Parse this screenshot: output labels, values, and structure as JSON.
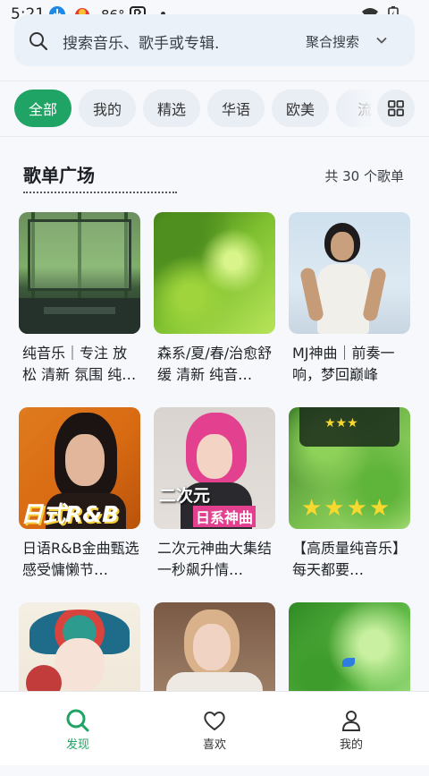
{
  "status_bar": {
    "time": "5:21",
    "temperature": "86°",
    "icons": [
      "download-icon",
      "app-badge-icon",
      "b-app-icon",
      "wifi-icon",
      "battery-icon"
    ]
  },
  "search": {
    "placeholder": "搜索音乐、歌手或专辑.",
    "mode": "聚合搜索"
  },
  "chips": [
    {
      "label": "全部",
      "active": true
    },
    {
      "label": "我的",
      "active": false
    },
    {
      "label": "精选",
      "active": false
    },
    {
      "label": "华语",
      "active": false
    },
    {
      "label": "欧美",
      "active": false
    },
    {
      "label": "流",
      "active": false
    }
  ],
  "section": {
    "title": "歌单广场",
    "count": "共 30 个歌单"
  },
  "playlists": [
    {
      "title": "纯音乐｜专注 放松 清新 氛围 纯…"
    },
    {
      "title": "森系/夏/春/治愈舒缓 清新 纯音…"
    },
    {
      "title": "MJ神曲｜前奏一响，梦回巅峰"
    },
    {
      "title": "日语R&B金曲甄选 感受慵懒节…",
      "cover_text": "日式R&B"
    },
    {
      "title": "二次元神曲大集结 一秒飙升情…",
      "cover_text_1": "二次元",
      "cover_text_2": "日系神曲"
    },
    {
      "title": "【高质量纯音乐】每天都要…"
    },
    {
      "title": ""
    },
    {
      "title": ""
    },
    {
      "title": ""
    }
  ],
  "nav": [
    {
      "label": "发现",
      "icon": "search-icon",
      "active": true
    },
    {
      "label": "喜欢",
      "icon": "heart-icon",
      "active": false
    },
    {
      "label": "我的",
      "icon": "person-icon",
      "active": false
    }
  ],
  "colors": {
    "accent": "#1fa465",
    "background": "#f6f8fb",
    "chip_bg": "#e9eef5"
  }
}
